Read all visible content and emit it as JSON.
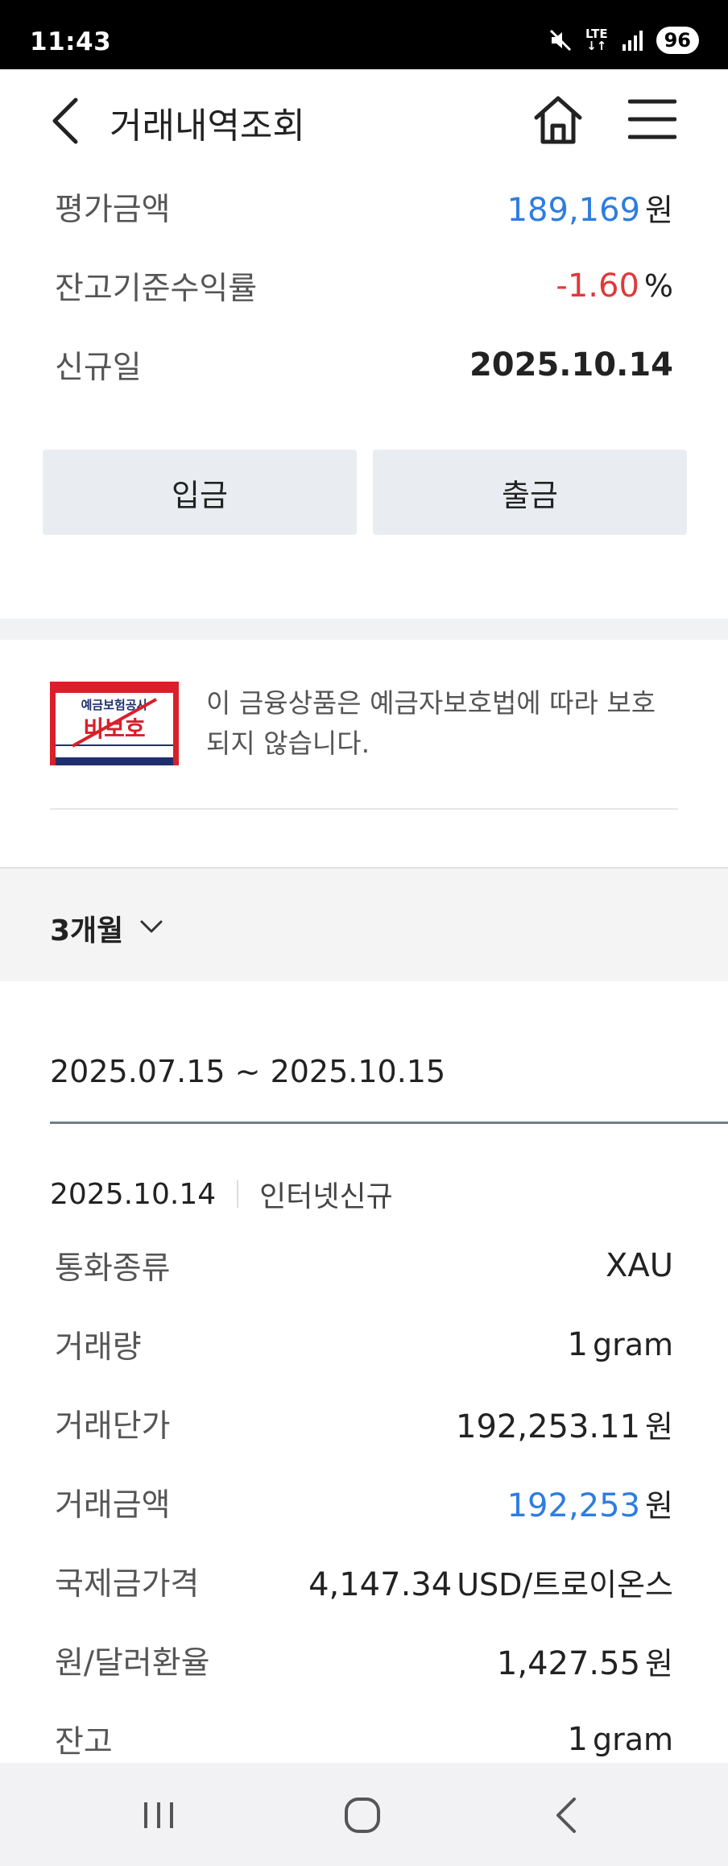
{
  "status": {
    "time": "11:43",
    "network": "LTE",
    "battery": "96"
  },
  "header": {
    "title": "거래내역조회"
  },
  "summary": [
    {
      "label": "평가금액",
      "value": "189,169",
      "unit": "원",
      "color": "#2e7de0"
    },
    {
      "label": "잔고기준수익률",
      "value": "-1.60",
      "unit": "%",
      "color": "#e0393b"
    },
    {
      "label": "신규일",
      "value": "2025.10.14",
      "unit": ""
    }
  ],
  "actions": {
    "deposit": "입금",
    "withdraw": "출금"
  },
  "protection": {
    "badge_top": "예금보험공사",
    "badge_main": "비보호",
    "notice": "이 금융상품은 예금자보호법에 따라 보호되지 않습니다."
  },
  "period": {
    "label": "3개월",
    "range": "2025.07.15 ~ 2025.10.15"
  },
  "transaction": {
    "date": "2025.10.14",
    "type": "인터넷신규",
    "details": [
      {
        "label": "통화종류",
        "value": "XAU",
        "unit": ""
      },
      {
        "label": "거래량",
        "value": "1",
        "unit": "gram"
      },
      {
        "label": "거래단가",
        "value": "192,253.11",
        "unit": "원"
      },
      {
        "label": "거래금액",
        "value": "192,253",
        "unit": "원",
        "color": "#2e7de0"
      },
      {
        "label": "국제금가격",
        "value": "4,147.34",
        "unit": "USD/트로이온스"
      },
      {
        "label": "원/달러환율",
        "value": "1,427.55",
        "unit": "원"
      },
      {
        "label": "잔고",
        "value": "1",
        "unit": "gram"
      }
    ]
  },
  "colors": {
    "accent_blue": "#2e7de0",
    "negative_red": "#e0393b",
    "badge_red": "#d8202a",
    "badge_navy": "#1f2f6e"
  }
}
